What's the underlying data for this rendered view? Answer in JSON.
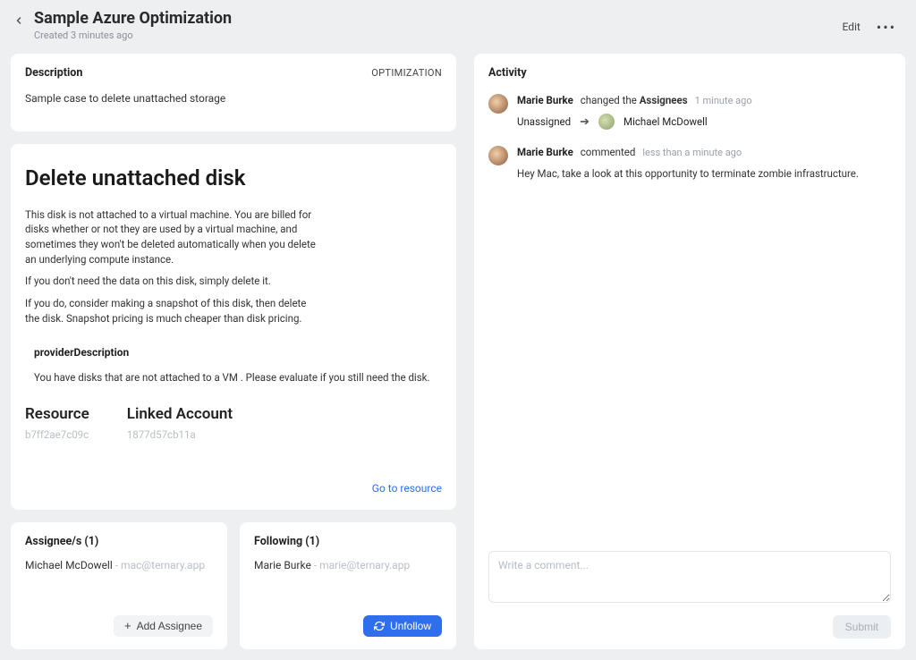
{
  "header": {
    "title": "Sample Azure Optimization",
    "subtitle": "Created 3 minutes ago",
    "edit_label": "Edit"
  },
  "description": {
    "title": "Description",
    "tag": "OPTIMIZATION",
    "text": "Sample case to delete unattached storage"
  },
  "opportunity": {
    "title": "Delete unattached disk",
    "para1": "This disk is not attached to a virtual machine. You are billed for disks whether or not they are used by a virtual machine, and sometimes they won't be deleted automatically when you delete an underlying compute instance.",
    "para2": "If you don't need the data on this disk, simply delete it.",
    "para3": "If you do, consider making a snapshot of this disk, then delete the disk. Snapshot pricing is much cheaper than disk pricing.",
    "provider_label": "providerDescription",
    "provider_text": "You have disks that are not attached to a VM . Please evaluate if you still need the disk.",
    "resource_label": "Resource",
    "resource_value": "b7ff2ae7c09c",
    "linked_label": "Linked Account",
    "linked_value": "1877d57cb11a",
    "goto_label": "Go to resource"
  },
  "assignees": {
    "title": "Assignee/s (1)",
    "person_name": "Michael McDowell",
    "person_sep": " - ",
    "person_email": "mac@ternary.app",
    "add_label": "Add Assignee"
  },
  "following": {
    "title": "Following (1)",
    "person_name": "Marie Burke",
    "person_sep": " - ",
    "person_email": "marie@ternary.app",
    "unfollow_label": "Unfollow"
  },
  "activity": {
    "title": "Activity",
    "items": [
      {
        "who": "Marie Burke",
        "action_pre": "changed the ",
        "action_bold": "Assignees",
        "time": "1 minute ago",
        "from": "Unassigned",
        "to": "Michael McDowell"
      },
      {
        "who": "Marie Burke",
        "action_pre": "commented",
        "action_bold": "",
        "time": "less than a minute ago",
        "comment": "Hey Mac, take a look at this opportunity to terminate zombie infrastructure."
      }
    ],
    "comment_placeholder": "Write a comment...",
    "submit_label": "Submit"
  }
}
